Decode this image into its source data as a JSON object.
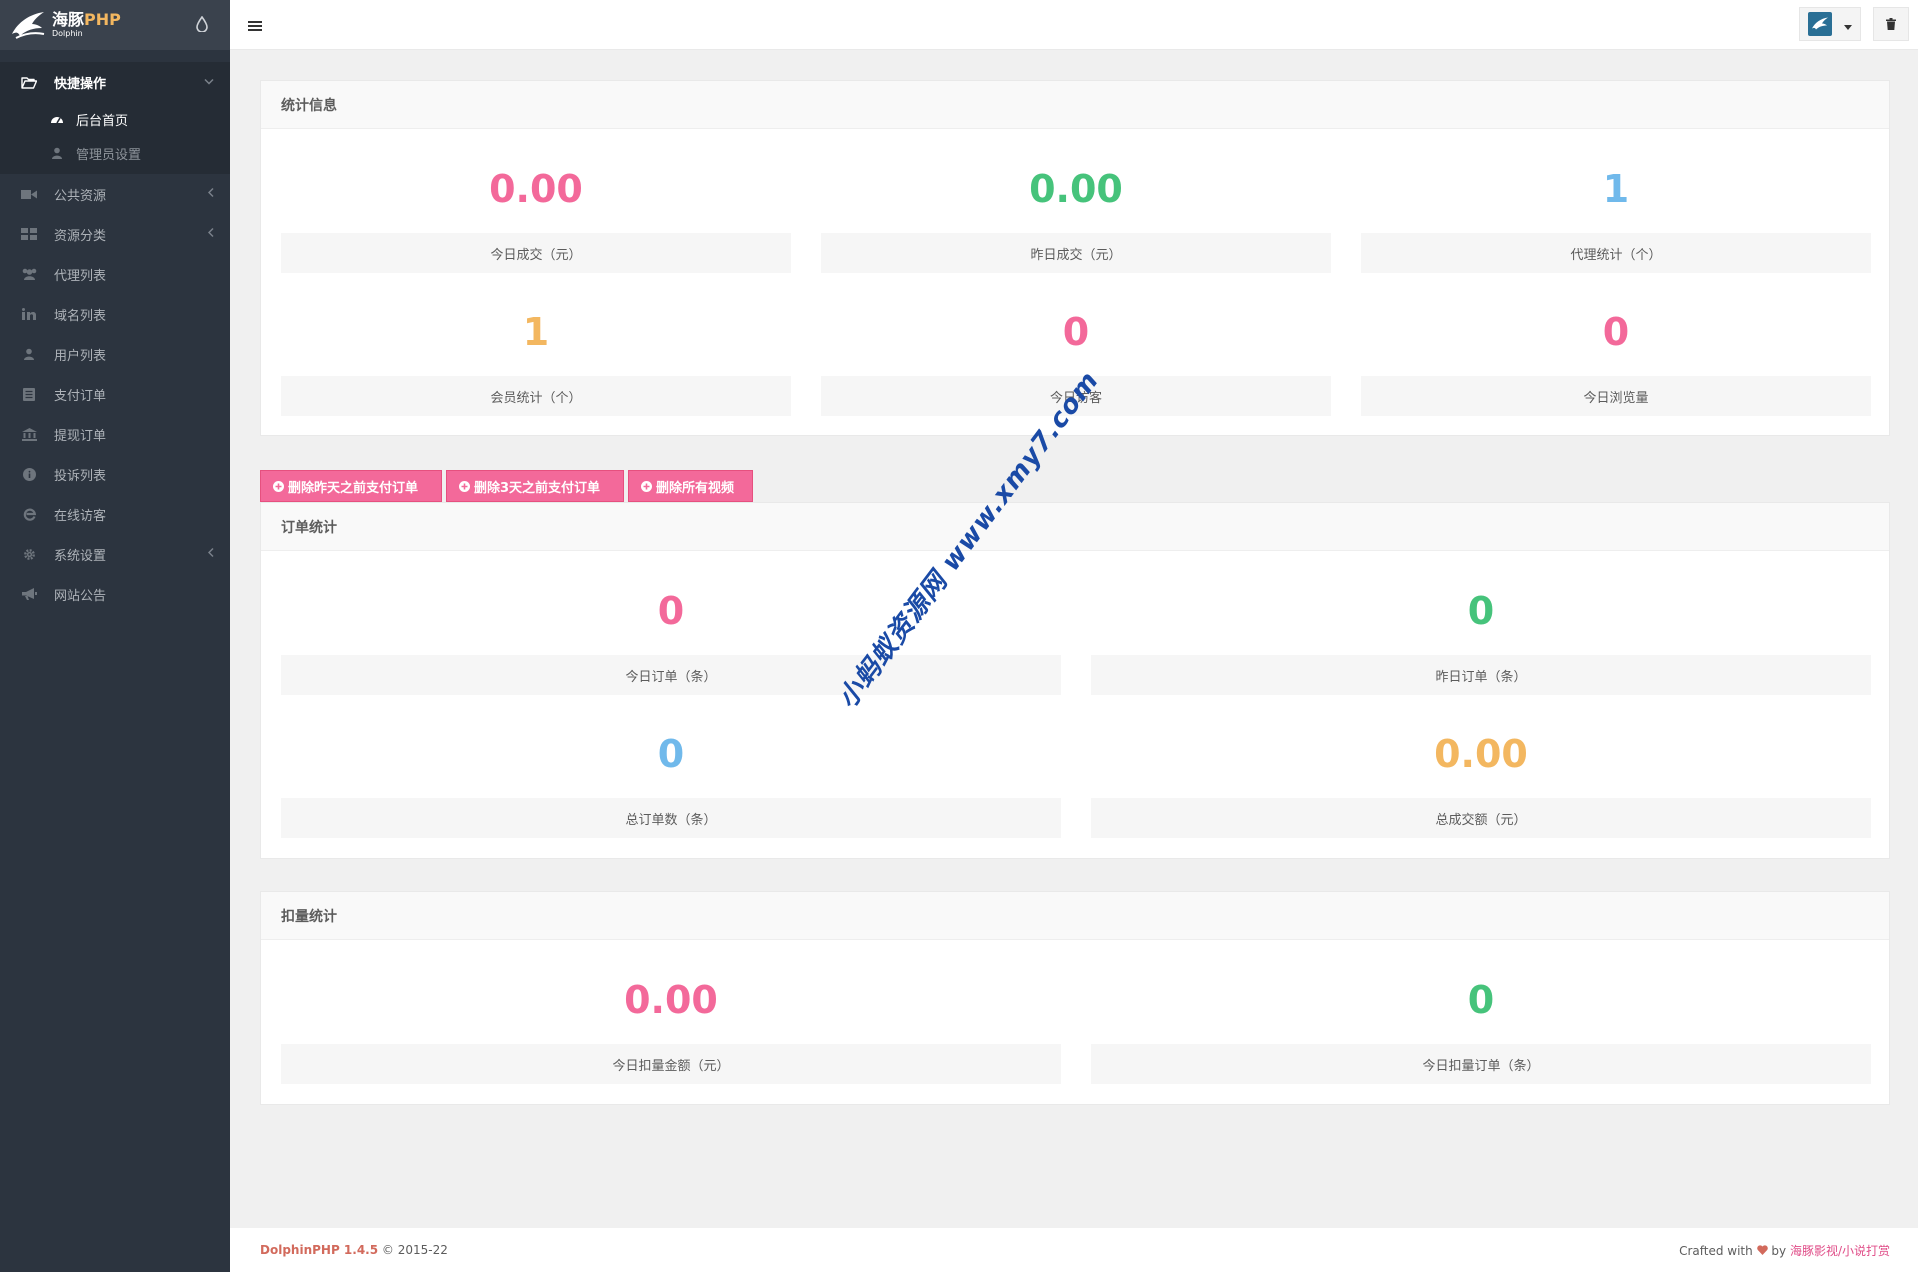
{
  "brand": {
    "name_main": "海豚",
    "name_php": "PHP",
    "name_sub": "Dolphin"
  },
  "sidebar": {
    "open_group": {
      "label": "快捷操作",
      "icon": "folder-open-icon"
    },
    "sub_items": [
      {
        "label": "后台首页",
        "icon": "dashboard-icon",
        "active": true
      },
      {
        "label": "管理员设置",
        "icon": "user-icon",
        "active": false
      }
    ],
    "items": [
      {
        "label": "公共资源",
        "icon": "video-camera-icon",
        "has_arrow": true
      },
      {
        "label": "资源分类",
        "icon": "th-large-icon",
        "has_arrow": true
      },
      {
        "label": "代理列表",
        "icon": "users-icon",
        "has_arrow": false
      },
      {
        "label": "域名列表",
        "icon": "linkedin-icon",
        "has_arrow": false
      },
      {
        "label": "用户列表",
        "icon": "user-icon",
        "has_arrow": false
      },
      {
        "label": "支付订单",
        "icon": "list-icon",
        "has_arrow": false
      },
      {
        "label": "提现订单",
        "icon": "bank-icon",
        "has_arrow": false
      },
      {
        "label": "投诉列表",
        "icon": "info-circle-icon",
        "has_arrow": false
      },
      {
        "label": "在线访客",
        "icon": "ie-icon",
        "has_arrow": false
      },
      {
        "label": "系统设置",
        "icon": "gear-icon",
        "has_arrow": true
      },
      {
        "label": "网站公告",
        "icon": "bullhorn-icon",
        "has_arrow": false
      }
    ]
  },
  "stats": {
    "title": "统计信息",
    "cells": [
      {
        "value": "0.00",
        "label": "今日成交（元）",
        "color": "#f3699a"
      },
      {
        "value": "0.00",
        "label": "昨日成交（元）",
        "color": "#46c37b"
      },
      {
        "value": "1",
        "label": "代理统计（个）",
        "color": "#70b9eb"
      },
      {
        "value": "1",
        "label": "会员统计（个）",
        "color": "#f3b760"
      },
      {
        "value": "0",
        "label": "今日访客",
        "color": "#f3699a"
      },
      {
        "value": "0",
        "label": "今日浏览量",
        "color": "#f3699a"
      }
    ]
  },
  "actions": [
    {
      "label": "删除昨天之前支付订单"
    },
    {
      "label": "删除3天之前支付订单"
    },
    {
      "label": "删除所有视频"
    }
  ],
  "orders": {
    "title": "订单统计",
    "cells": [
      {
        "value": "0",
        "label": "今日订单（条）",
        "color": "#f3699a"
      },
      {
        "value": "0",
        "label": "昨日订单（条）",
        "color": "#46c37b"
      },
      {
        "value": "0",
        "label": "总订单数（条）",
        "color": "#70b9eb"
      },
      {
        "value": "0.00",
        "label": "总成交额（元）",
        "color": "#f3b760"
      }
    ]
  },
  "deduct": {
    "title": "扣量统计",
    "cells": [
      {
        "value": "0.00",
        "label": "今日扣量金额（元）",
        "color": "#f3699a"
      },
      {
        "value": "0",
        "label": "今日扣量订单（条）",
        "color": "#46c37b"
      }
    ]
  },
  "footer": {
    "product": "DolphinPHP 1.4.5",
    "copyright": "© 2015-22",
    "crafted_prefix": "Crafted with",
    "crafted_by": "by",
    "author": "海豚影视/小说打赏"
  },
  "watermark": "小蚂蚁资源网 www.xmy7.com",
  "colors": {
    "sidebar_bg": "#2c343f",
    "accent_pink": "#f3699a",
    "accent_green": "#46c37b",
    "accent_blue": "#70b9eb",
    "accent_orange": "#f3b760"
  }
}
